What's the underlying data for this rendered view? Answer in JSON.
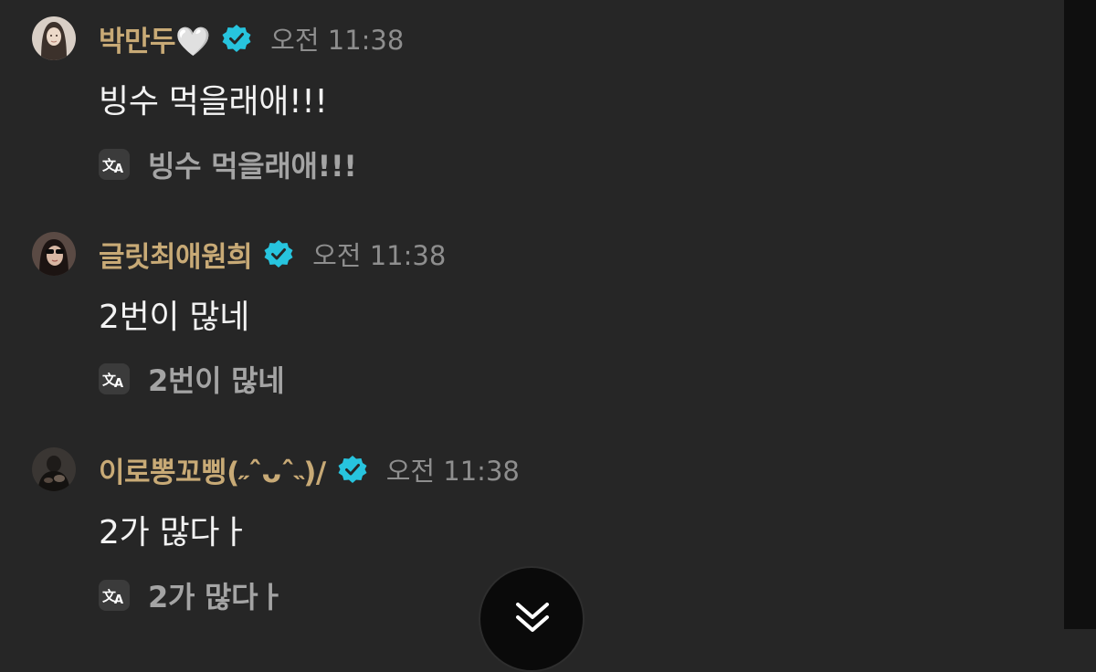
{
  "messages": [
    {
      "username": "박만두🤍",
      "time": "오전 11:38",
      "text": "빙수 먹을래애!!!",
      "translation": "빙수 먹을래애!!!",
      "avatar_icon": "avatar-girl-long-hair"
    },
    {
      "username": "글릿최애원희",
      "time": "오전 11:38",
      "text": "2번이 많네",
      "translation": "2번이 많네",
      "avatar_icon": "avatar-girl-sunglasses"
    },
    {
      "username": "이로뽕꼬삥(˶ˆᴗˆ˵)/",
      "time": "오전 11:38",
      "text": "2가 많다ㅏ",
      "translation": "2가 많다ㅏ",
      "avatar_icon": "avatar-person-dark"
    }
  ],
  "colors": {
    "background": "#262626",
    "username": "#c8aa76",
    "time": "#8e8e8e",
    "message_text": "#f2f2f2",
    "translation_text": "#a4a4a4",
    "verified_badge": "#27c4de"
  },
  "icons": {
    "verified": "verified-badge-icon",
    "translate": "translate-icon",
    "scroll_down": "double-chevron-down-icon"
  }
}
